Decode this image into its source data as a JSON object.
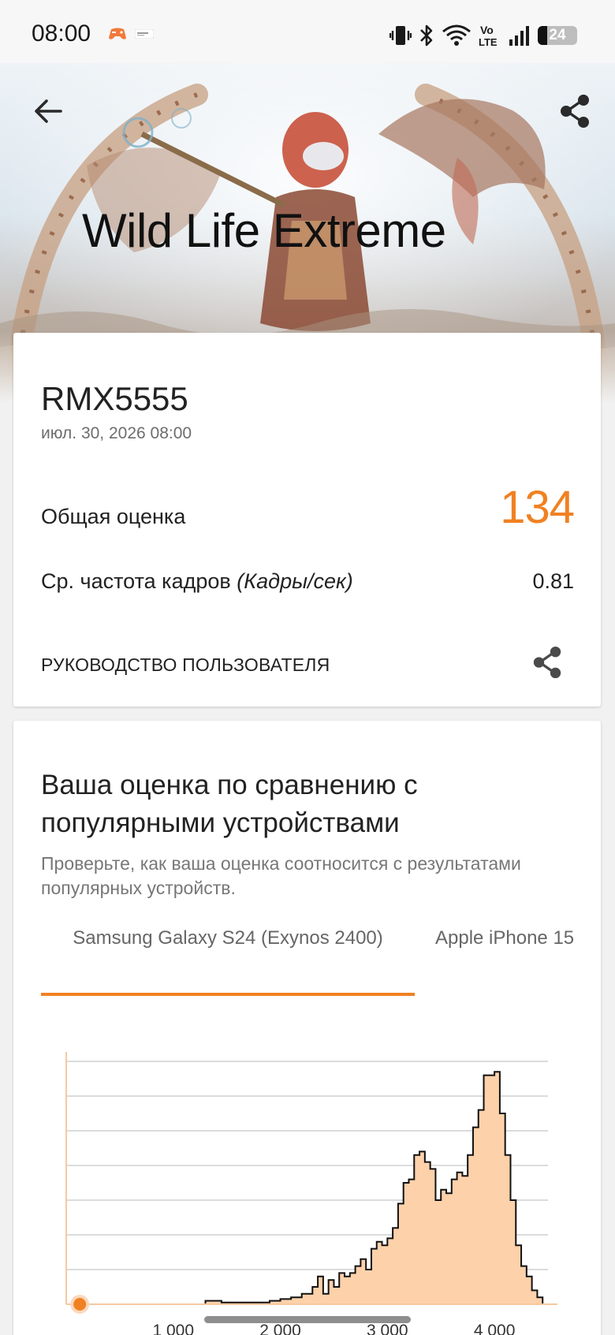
{
  "status_bar": {
    "time": "08:00",
    "notification_icons": [
      "game-controller-icon",
      "app-notification-icon"
    ],
    "right_icons": [
      "vibrate-icon",
      "bluetooth-icon",
      "wifi-icon",
      "volte-icon",
      "signal-icon"
    ],
    "volte_top": "Vo",
    "volte_bottom": "LTE",
    "battery_level": "24"
  },
  "hero": {
    "title": "Wild Life Extreme",
    "back_icon": "arrow-left-icon",
    "share_icon": "share-icon"
  },
  "result": {
    "device": "RMX5555",
    "date": "июл. 30, 2026 08:00",
    "score_label": "Общая оценка",
    "score_value": "134",
    "fps_label": "Ср. частота кадров",
    "fps_unit": "(Кадры/сек)",
    "fps_value": "0.81",
    "guide_link": "РУКОВОДСТВО ПОЛЬЗОВАТЕЛЯ",
    "guide_share_icon": "share-icon"
  },
  "comparison": {
    "title": "Ваша оценка по сравнению с популярными устройствами",
    "subtitle": "Проверьте, как ваша оценка соотносится с результатами популярных устройств.",
    "tabs": [
      {
        "label": "Samsung Galaxy S24 (Exynos 2400)",
        "selected": true
      },
      {
        "label": "Apple iPhone 15",
        "selected": false
      }
    ]
  },
  "colors": {
    "accent": "#f08122",
    "histogram_fill": "#fdd1aa",
    "text_primary": "#222222",
    "text_secondary": "#777777"
  },
  "chart_data": {
    "type": "area",
    "title": "",
    "xlabel": "",
    "ylabel": "",
    "xlim": [
      0,
      4500
    ],
    "ylim": [
      0,
      7
    ],
    "grid": true,
    "xticks": [
      "1 000",
      "2 000",
      "3 000",
      "4 000"
    ],
    "xtick_values": [
      1000,
      2000,
      3000,
      4000
    ],
    "marker": {
      "label": "",
      "x": 134,
      "color": "#f08122"
    },
    "series": [
      {
        "x": [
          0,
          1250,
          1300,
          1400,
          1450,
          1700,
          1900,
          2000,
          2100,
          2200,
          2300,
          2350,
          2400,
          2450,
          2500,
          2550,
          2600,
          2650,
          2700,
          2750,
          2800,
          2850,
          2900,
          2950,
          3000,
          3050,
          3100,
          3150,
          3200,
          3250,
          3300,
          3350,
          3400,
          3450,
          3500,
          3550,
          3600,
          3650,
          3700,
          3750,
          3800,
          3850,
          3900,
          3950,
          4000,
          4050,
          4100,
          4150,
          4200,
          4250,
          4300,
          4350,
          4400,
          4450,
          4500
        ],
        "values": [
          0,
          0,
          0.1,
          0.1,
          0.05,
          0.05,
          0.1,
          0.15,
          0.2,
          0.3,
          0.5,
          0.8,
          0.3,
          0.7,
          0.5,
          0.9,
          0.8,
          0.9,
          1.1,
          1.3,
          1.0,
          1.6,
          1.8,
          1.7,
          1.9,
          2.2,
          2.9,
          3.5,
          3.6,
          4.3,
          4.4,
          4.1,
          3.9,
          3.0,
          3.3,
          3.2,
          3.6,
          3.8,
          3.7,
          4.3,
          5.1,
          5.6,
          6.6,
          6.6,
          6.7,
          5.5,
          4.3,
          3.0,
          1.7,
          1.1,
          0.8,
          0.4,
          0.2,
          0.0,
          0
        ]
      }
    ]
  }
}
